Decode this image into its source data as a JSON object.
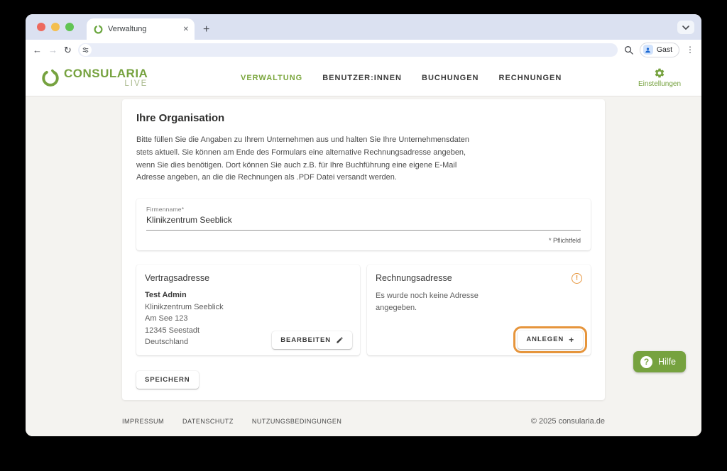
{
  "browser": {
    "tab": {
      "title": "Verwaltung"
    },
    "profile": {
      "label": "Gast"
    },
    "icons": {
      "close": "✕",
      "new_tab": "+",
      "back": "←",
      "forward": "→",
      "reload": "↻",
      "more": "⋮"
    }
  },
  "header": {
    "logo": {
      "name": "CONSULARIA",
      "sub": "LIVE"
    },
    "nav": [
      {
        "label": "VERWALTUNG",
        "active": true
      },
      {
        "label": "BENUTZER:INNEN",
        "active": false
      },
      {
        "label": "BUCHUNGEN",
        "active": false
      },
      {
        "label": "RECHNUNGEN",
        "active": false
      }
    ],
    "settings_label": "Einstellungen"
  },
  "main": {
    "title": "Ihre Organisation",
    "description": "Bitte füllen Sie die Angaben zu Ihrem Unternehmen aus und halten Sie Ihre Unternehmensdaten stets aktuell. Sie können am Ende des Formulars eine alternative Rechnungsadresse angeben, wenn Sie dies benötigen. Dort können Sie auch z.B. für Ihre Buchführung eine eigene E-Mail Adresse angeben, an die die Rechnungen als .PDF Datei versandt werden.",
    "company_field": {
      "label": "Firmenname*",
      "value": "Klinikzentrum Seeblick",
      "required_note": "* Pflichtfeld"
    },
    "contract_address": {
      "title": "Vertragsadresse",
      "name": "Test Admin",
      "lines": [
        "Klinikzentrum Seeblick",
        "Am See 123",
        "12345 Seestadt",
        "Deutschland"
      ],
      "edit_label": "BEARBEITEN"
    },
    "billing_address": {
      "title": "Rechnungsadresse",
      "warning_glyph": "!",
      "empty_text": "Es wurde noch keine Adresse angegeben.",
      "create_label": "ANLEGEN",
      "plus_glyph": "+"
    },
    "save_label": "SPEICHERN"
  },
  "footer": {
    "links": [
      "IMPRESSUM",
      "DATENSCHUTZ",
      "NUTZUNGSBEDINGUNGEN"
    ],
    "copyright": "© 2025 consularia.de"
  },
  "help": {
    "label": "Hilfe",
    "question_glyph": "?"
  },
  "colors": {
    "brand_green": "#76a23f",
    "accent_orange": "#e6953c"
  }
}
